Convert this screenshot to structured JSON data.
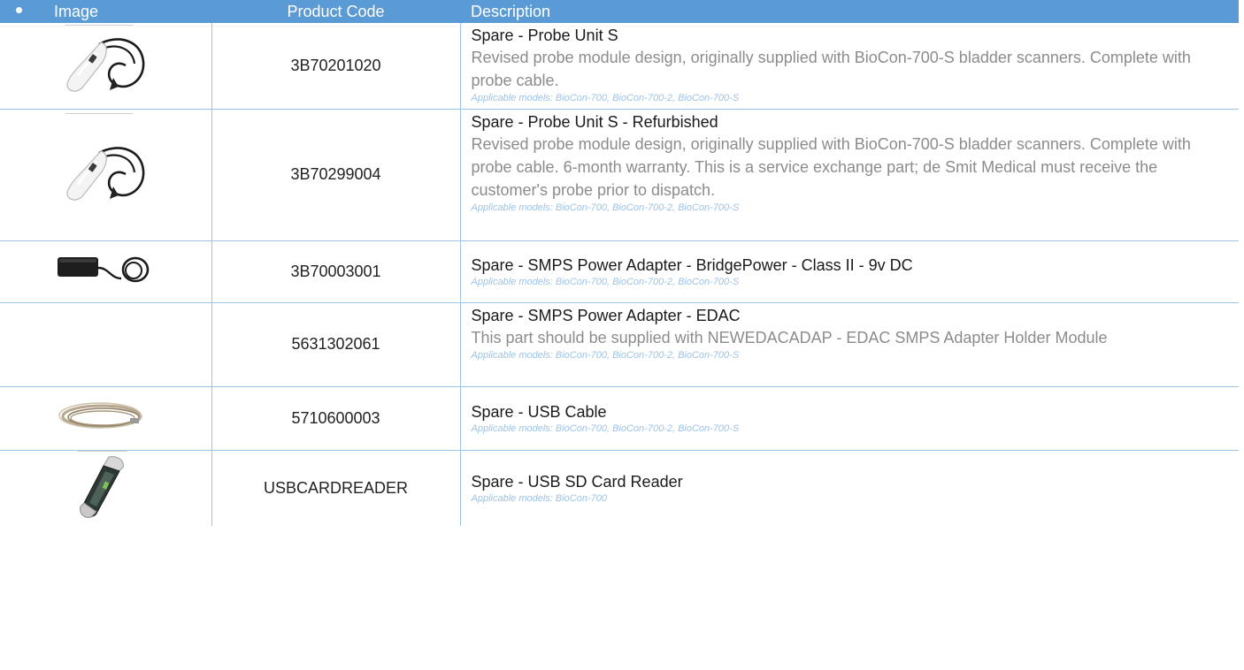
{
  "header": {
    "image": "Image",
    "product_code": "Product Code",
    "description": "Description"
  },
  "rows": [
    {
      "image": "probe-unit-icon",
      "code": "3B70201020",
      "title": "Spare - Probe Unit S",
      "text": "Revised probe module design, originally supplied with BioCon-700-S bladder scanners. Complete with probe cable.",
      "models": "Applicable models: BioCon-700, BioCon-700-2, BioCon-700-S"
    },
    {
      "image": "probe-unit-icon",
      "code": "3B70299004",
      "title": "Spare - Probe Unit S - Refurbished",
      "text": "Revised probe module design, originally supplied with BioCon-700-S bladder scanners. Complete with probe cable. 6-month warranty. This is a service exchange part; de Smit Medical must receive the customer's probe prior to dispatch.",
      "models": "Applicable models: BioCon-700, BioCon-700-2, BioCon-700-S"
    },
    {
      "image": "power-adapter-icon",
      "code": "3B70003001",
      "title": "Spare - SMPS Power Adapter - BridgePower - Class II - 9v DC",
      "text": "",
      "models": "Applicable models: BioCon-700, BioCon-700-2, BioCon-700-S"
    },
    {
      "image": "",
      "code": "5631302061",
      "title": "Spare - SMPS Power Adapter - EDAC",
      "text": "This part should be supplied with NEWEDACADAP - EDAC SMPS Adapter Holder Module",
      "models": "Applicable models: BioCon-700, BioCon-700-2, BioCon-700-S"
    },
    {
      "image": "usb-cable-icon",
      "code": "5710600003",
      "title": "Spare - USB Cable",
      "text": "",
      "models": "Applicable models: BioCon-700, BioCon-700-2, BioCon-700-S"
    },
    {
      "image": "card-reader-icon",
      "code": "USBCARDREADER",
      "title": "Spare - USB SD Card Reader",
      "text": "",
      "models": "Applicable models: BioCon-700"
    }
  ]
}
